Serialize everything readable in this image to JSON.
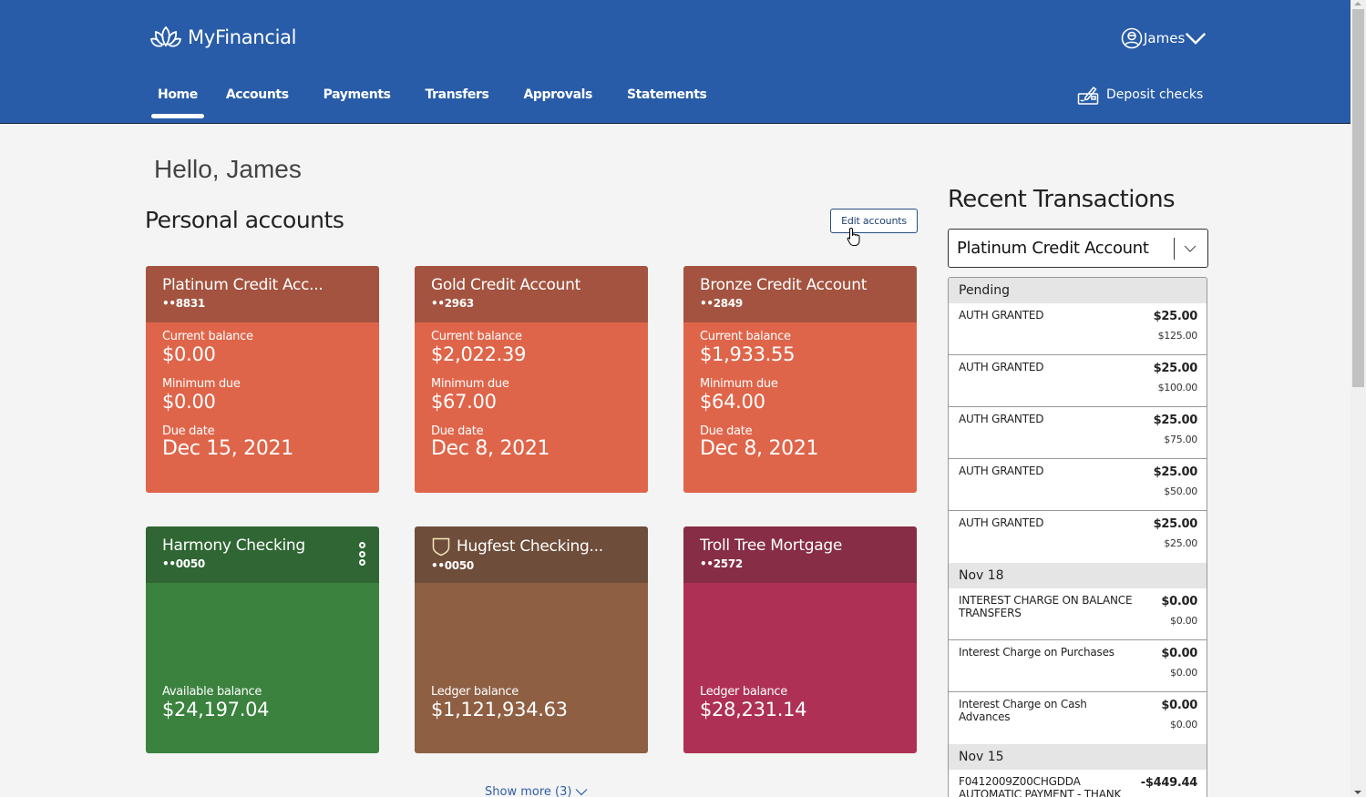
{
  "brand": {
    "name": "MyFinancial",
    "logo_icon": "lotus-icon"
  },
  "user": {
    "name": "James",
    "icon": "user-circle-icon",
    "caret_icon": "chevron-down-icon"
  },
  "nav": {
    "tabs": [
      {
        "label": "Home",
        "active": true
      },
      {
        "label": "Accounts",
        "active": false
      },
      {
        "label": "Payments",
        "active": false
      },
      {
        "label": "Transfers",
        "active": false
      },
      {
        "label": "Approvals",
        "active": false
      },
      {
        "label": "Statements",
        "active": false
      }
    ],
    "deposit": {
      "label": "Deposit checks",
      "icon": "deposit-check-icon"
    }
  },
  "greeting": "Hello, James",
  "personal_accounts": {
    "title": "Personal accounts",
    "edit_label": "Edit accounts",
    "credit_cards": [
      {
        "name": "Platinum Credit Acc...",
        "number": "••8831",
        "balance_label": "Current balance",
        "balance": "$0.00",
        "min_label": "Minimum due",
        "min_due": "$0.00",
        "due_label": "Due date",
        "due_date": "Dec 15, 2021"
      },
      {
        "name": "Gold Credit Account",
        "number": "••2963",
        "balance_label": "Current balance",
        "balance": "$2,022.39",
        "min_label": "Minimum due",
        "min_due": "$67.00",
        "due_label": "Due date",
        "due_date": "Dec 8, 2021"
      },
      {
        "name": "Bronze Credit Account",
        "number": "••2849",
        "balance_label": "Current balance",
        "balance": "$1,933.55",
        "min_label": "Minimum due",
        "min_due": "$64.00",
        "due_label": "Due date",
        "due_date": "Dec 8, 2021"
      }
    ],
    "deposit_accounts": [
      {
        "name": "Harmony Checking",
        "number": "••0050",
        "balance_label": "Available balance",
        "balance": "$24,197.04",
        "has_menu": true
      },
      {
        "name": "Hugfest Checking...",
        "number": "••0050",
        "balance_label": "Ledger balance",
        "balance": "$1,121,934.63",
        "icon": "shield-icon"
      },
      {
        "name": "Troll Tree Mortgage",
        "number": "••2572",
        "balance_label": "Ledger balance",
        "balance": "$28,231.14"
      }
    ],
    "show_more": "Show more (3)"
  },
  "recent_transactions": {
    "title": "Recent Transactions",
    "selected_account": "Platinum Credit Account",
    "groups": [
      {
        "label": "Pending",
        "items": [
          {
            "desc": "AUTH GRANTED",
            "amount": "$25.00",
            "balance": "$125.00"
          },
          {
            "desc": "AUTH GRANTED",
            "amount": "$25.00",
            "balance": "$100.00"
          },
          {
            "desc": "AUTH GRANTED",
            "amount": "$25.00",
            "balance": "$75.00"
          },
          {
            "desc": "AUTH GRANTED",
            "amount": "$25.00",
            "balance": "$50.00"
          },
          {
            "desc": "AUTH GRANTED",
            "amount": "$25.00",
            "balance": "$25.00"
          }
        ]
      },
      {
        "label": "Nov 18",
        "items": [
          {
            "desc": "INTEREST CHARGE ON BALANCE TRANSFERS",
            "amount": "$0.00",
            "balance": "$0.00"
          },
          {
            "desc": "Interest Charge on Purchases",
            "amount": "$0.00",
            "balance": "$0.00"
          },
          {
            "desc": "Interest Charge on Cash Advances",
            "amount": "$0.00",
            "balance": "$0.00"
          }
        ]
      },
      {
        "label": "Nov 15",
        "items": [
          {
            "desc": "F0412009Z00CHGDDA AUTOMATIC PAYMENT - THANK",
            "amount": "-$449.44",
            "balance": ""
          }
        ]
      }
    ]
  },
  "colors": {
    "header": "#285ca8",
    "credit_head": "#a3533f",
    "credit_body": "#df654a",
    "checking_green_head": "#2f6633",
    "checking_green_body": "#3a823e",
    "checking_brown_head": "#6e4d3a",
    "checking_brown_body": "#8f5f43",
    "mortgage_head": "#872d45",
    "mortgage_body": "#ae3155"
  }
}
